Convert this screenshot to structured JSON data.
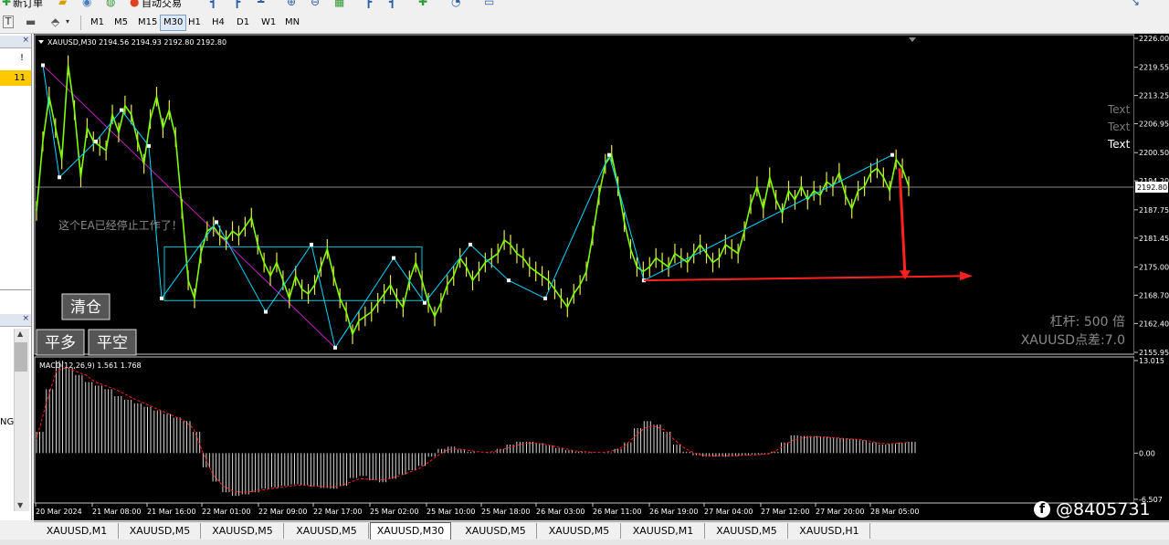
{
  "toolbar": {
    "top_label": "新订单",
    "autotrade_label": "自动交易",
    "timeframes": [
      "M1",
      "M5",
      "M15",
      "M30",
      "H1",
      "H4",
      "D1",
      "W1",
      "MN"
    ],
    "active_timeframe": "M30"
  },
  "left_panel": {
    "close_glyph": "×",
    "cells": [
      "!",
      "11"
    ],
    "partial_text": "NG",
    "scroll_up": "▲",
    "scroll_down": "▼"
  },
  "chart": {
    "header": "XAUUSD,M30  2194.56 2194.93 2192.80 2192.80",
    "current_price": "2192.80",
    "price_ticks": [
      "2226.00",
      "2219.55",
      "2213.25",
      "2206.95",
      "2200.50",
      "2194.20",
      "2187.75",
      "2181.45",
      "2175.00",
      "2168.70",
      "2162.40",
      "2155.95"
    ],
    "time_ticks": [
      "20 Mar 2024",
      "21 Mar 08:00",
      "21 Mar 16:00",
      "22 Mar 01:00",
      "22 Mar 09:00",
      "22 Mar 17:00",
      "25 Mar 02:00",
      "25 Mar 10:00",
      "25 Mar 18:00",
      "26 Mar 03:00",
      "26 Mar 11:00",
      "26 Mar 19:00",
      "27 Mar 04:00",
      "27 Mar 12:00",
      "27 Mar 20:00",
      "28 Mar 05:00"
    ],
    "ea_message": "这个EA已经停止工作了！",
    "text_labels": [
      "Text",
      "Text",
      "Text"
    ],
    "leverage": "杠杆: 500 倍",
    "spread": "XAUUSD点差:7.0",
    "buttons": {
      "close_all": "清仓",
      "close_long": "平多",
      "close_short": "平空"
    },
    "colors": {
      "background": "#000000",
      "price_line": "#7fff00",
      "zigzag": "#00d8ff",
      "trend": "#c020c0",
      "arrow": "#ff2020",
      "macd_signal": "#ff2020"
    },
    "macd": {
      "header": "MACD(12,26,9) 1.561 1.768",
      "ticks": [
        "13.015",
        "0.00",
        "-6.507"
      ]
    }
  },
  "chart_data": {
    "type": "line",
    "title": "XAUUSD,M30",
    "xlabel": "",
    "ylabel": "",
    "ylim": [
      2155.95,
      2226.0
    ],
    "series": [
      {
        "name": "XAUUSD,M30",
        "values": [
          2187.5,
          2203,
          2213,
          2206,
          2199,
          2220,
          2210,
          2195,
          2206,
          2203,
          2202,
          2201,
          2209,
          2205,
          2211,
          2209,
          2203,
          2198,
          2208,
          2213,
          2206,
          2210,
          2204,
          2188,
          2172,
          2168,
          2178,
          2183,
          2184,
          2182,
          2181,
          2183,
          2182,
          2184,
          2186,
          2180,
          2176,
          2173,
          2176,
          2172,
          2168,
          2173,
          2170,
          2169,
          2171,
          2175,
          2179,
          2173,
          2168,
          2165,
          2160,
          2163,
          2164,
          2165,
          2167,
          2169,
          2171,
          2168,
          2166,
          2172,
          2176,
          2172,
          2167,
          2164,
          2167,
          2171,
          2173,
          2177,
          2175,
          2172,
          2174,
          2176,
          2177,
          2178,
          2181,
          2180,
          2178,
          2177,
          2175,
          2174,
          2173,
          2172,
          2170,
          2168,
          2166,
          2169,
          2171,
          2174,
          2182,
          2191,
          2198,
          2200,
          2193,
          2185,
          2179,
          2175,
          2174,
          2175,
          2177,
          2176,
          2175,
          2178,
          2177,
          2176,
          2178,
          2180,
          2178,
          2176,
          2177,
          2180,
          2179,
          2178,
          2183,
          2189,
          2193,
          2188,
          2195,
          2190,
          2187,
          2192,
          2190,
          2193,
          2190,
          2192,
          2191,
          2194,
          2193,
          2196,
          2191,
          2188,
          2192,
          2193,
          2196,
          2197,
          2195,
          2192,
          2199,
          2197,
          2193
        ]
      },
      {
        "name": "MACD",
        "values": [
          3,
          9,
          13,
          12,
          11,
          10,
          9.5,
          9,
          8,
          7.5,
          7,
          6.5,
          6,
          5.5,
          5,
          4.5,
          3,
          -2,
          -4,
          -5.5,
          -6,
          -5.8,
          -5.5,
          -5,
          -4.8,
          -4.6,
          -4.4,
          -4.5,
          -4.7,
          -4.9,
          -5,
          -4.6,
          -3.5,
          -3.2,
          -3.8,
          -4.1,
          -3.6,
          -3,
          -2.4,
          -1.8,
          -0.5,
          0.6,
          0.9,
          0.5,
          0.2,
          0,
          0.1,
          0.6,
          1.2,
          1.6,
          1.6,
          1.4,
          1.1,
          0.7,
          0.4,
          0.2,
          0.1,
          0,
          0.1,
          0.6,
          1.5,
          3.5,
          4.5,
          4,
          3,
          1.2,
          0.2,
          -0.3,
          -0.5,
          -0.5,
          -0.5,
          -0.4,
          -0.3,
          -0.2,
          -0.2,
          0.2,
          1.5,
          2.5,
          2.4,
          2.4,
          2.3,
          2.2,
          2.1,
          2,
          1.8,
          1.5,
          1.2,
          1.3,
          1.5,
          1.6
        ]
      },
      {
        "name": "Signal",
        "values": [
          2,
          7,
          11.5,
          12,
          11.5,
          11,
          10,
          9.5,
          9,
          8.3,
          7.6,
          7,
          6.4,
          5.8,
          5.2,
          4.6,
          3.5,
          0,
          -3,
          -4.6,
          -5.3,
          -5.5,
          -5.4,
          -5.2,
          -5,
          -4.8,
          -4.6,
          -4.5,
          -4.6,
          -4.7,
          -4.8,
          -4.6,
          -4.1,
          -3.6,
          -3.7,
          -3.8,
          -3.6,
          -3.2,
          -2.7,
          -2.2,
          -1.3,
          -0.3,
          0.5,
          0.6,
          0.4,
          0.2,
          0.1,
          0.3,
          0.7,
          1.1,
          1.4,
          1.4,
          1.2,
          0.9,
          0.6,
          0.3,
          0.2,
          0.1,
          0.1,
          0.4,
          1,
          2.3,
          3.5,
          3.8,
          3.3,
          2,
          0.8,
          0.1,
          -0.3,
          -0.4,
          -0.4,
          -0.4,
          -0.3,
          -0.3,
          -0.2,
          0,
          0.8,
          1.7,
          2.1,
          2.3,
          2.3,
          2.2,
          2.1,
          2,
          1.9,
          1.7,
          1.4,
          1.3,
          1.4,
          1.5
        ]
      }
    ]
  },
  "tabs": [
    "XAUUSD,M1",
    "XAUUSD,M5",
    "XAUUSD,M5",
    "XAUUSD,M5",
    "XAUUSD,M30",
    "XAUUSD,M5",
    "XAUUSD,M5",
    "XAUUSD,M1",
    "XAUUSD,M5",
    "XAUUSD,H1"
  ],
  "active_tab": 4,
  "watermark": "@8405731",
  "watermark_logo": "f"
}
